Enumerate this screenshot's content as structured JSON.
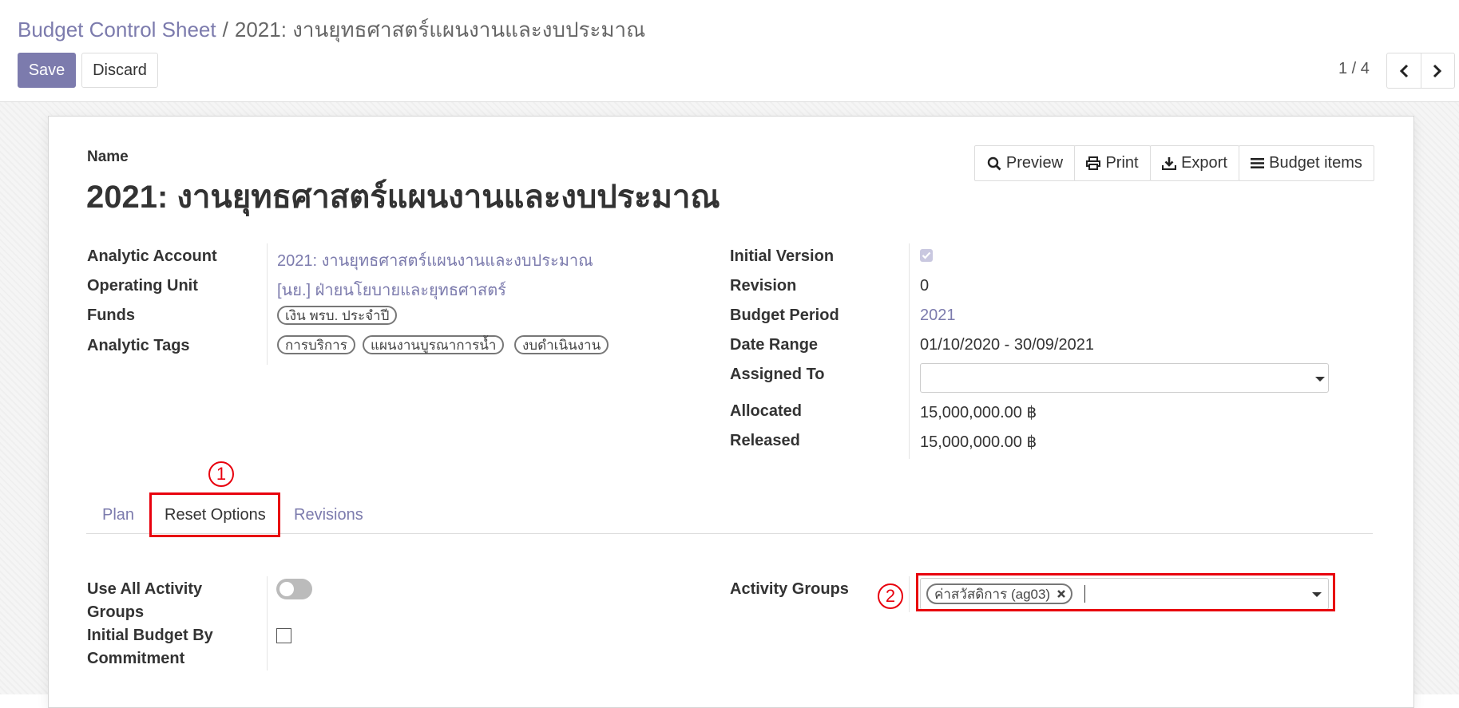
{
  "breadcrumb": {
    "parent": "Budget Control Sheet",
    "separator": "/",
    "current": "2021: งานยุทธศาสตร์แผนงานและงบประมาณ"
  },
  "toolbar": {
    "save_label": "Save",
    "discard_label": "Discard"
  },
  "pager": {
    "value": "1 / 4"
  },
  "form": {
    "name_label": "Name",
    "name_value": "2021: งานยุทธศาสตร์แผนงานและงบประมาณ",
    "buttons": {
      "preview": "Preview",
      "print": "Print",
      "export": "Export",
      "budget_items": "Budget items"
    },
    "left": {
      "analytic_account_label": "Analytic Account",
      "analytic_account_value": "2021: งานยุทธศาสตร์แผนงานและงบประมาณ",
      "operating_unit_label": "Operating Unit",
      "operating_unit_value": "[นย.] ฝ่ายนโยบายและยุทธศาสตร์",
      "funds_label": "Funds",
      "funds_tags": [
        "เงิน พรบ. ประจำปี"
      ],
      "analytic_tags_label": "Analytic Tags",
      "analytic_tags": [
        "การบริการ",
        "แผนงานบูรณาการน้ำ",
        "งบดำเนินงาน"
      ]
    },
    "right": {
      "initial_version_label": "Initial Version",
      "initial_version_checked": true,
      "revision_label": "Revision",
      "revision_value": "0",
      "budget_period_label": "Budget Period",
      "budget_period_value": "2021",
      "date_range_label": "Date Range",
      "date_range_value": "01/10/2020 - 30/09/2021",
      "assigned_to_label": "Assigned To",
      "assigned_to_value": "",
      "allocated_label": "Allocated",
      "allocated_value": "15,000,000.00 ฿",
      "released_label": "Released",
      "released_value": "15,000,000.00 ฿"
    }
  },
  "tabs": [
    {
      "label": "Plan",
      "active": false
    },
    {
      "label": "Reset Options",
      "active": true
    },
    {
      "label": "Revisions",
      "active": false
    }
  ],
  "reset_options": {
    "use_all_label_line1": "Use All Activity",
    "use_all_label_line2": "Groups",
    "use_all_value": false,
    "initial_budget_label_line1": "Initial Budget By",
    "initial_budget_label_line2": "Commitment",
    "initial_budget_value": false,
    "activity_groups_label": "Activity Groups",
    "activity_groups_tags": [
      "ค่าสวัสดิการ (ag03)"
    ]
  },
  "annotations": {
    "marker_1": "1",
    "marker_2": "2"
  },
  "colors": {
    "accent": "#7c7bad",
    "highlight": "#e8000d"
  },
  "icons": {
    "preview": "search-icon",
    "print": "print-icon",
    "export": "download-icon",
    "budget_items": "list-icon",
    "prev": "chevron-left-icon",
    "next": "chevron-right-icon",
    "remove_tag": "close-icon",
    "dropdown": "caret-down-icon"
  }
}
